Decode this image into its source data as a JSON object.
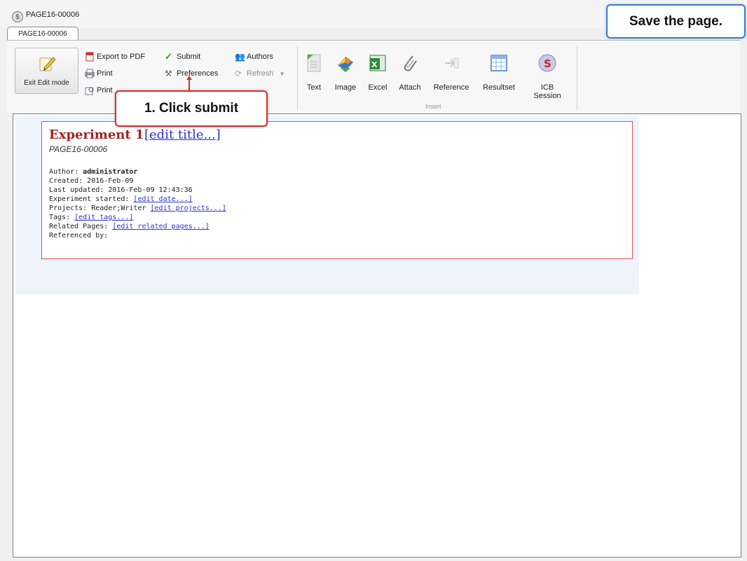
{
  "window": {
    "title": "PAGE16-00006",
    "tab_label": "PAGE16-00006"
  },
  "toolbar": {
    "exit_edit_mode": "Exit Edit mode",
    "export_pdf": "Export to PDF",
    "print": "Print",
    "print_other": "Print",
    "submit": "Submit",
    "preferences": "Preferences",
    "authors": "Authors",
    "refresh": "Refresh",
    "insert_items": {
      "text": "Text",
      "image": "Image",
      "excel": "Excel",
      "attach": "Attach",
      "reference": "Reference",
      "resultset": "Resultset",
      "icb_session": "ICB Session"
    },
    "insert_group_label": "Insert"
  },
  "page": {
    "title": "Experiment 1",
    "edit_title": "[edit title...]",
    "page_id": "PAGE16-00006",
    "author_label": "Author:",
    "author_value": "administrator",
    "created": "Created: 2016-Feb-09",
    "last_updated": "Last updated: 2016-Feb-09 12:43:36",
    "experiment_started_label": "Experiment started:",
    "experiment_started_link": "[edit date...]",
    "projects_label": "Projects: Reader;Writer",
    "projects_link": "[edit projects...]",
    "tags_label": "Tags:",
    "tags_link": "[edit tags...]",
    "related_label": "Related Pages:",
    "related_link": "[edit related pages...]",
    "referenced_by": "Referenced by:"
  },
  "callouts": {
    "step": "1. Click submit",
    "goal": "Save the page."
  },
  "colors": {
    "callout_red": "#e12a2a",
    "callout_blue": "#2e7dd7",
    "title_red": "#a32222",
    "link_blue": "#2b34c9"
  }
}
